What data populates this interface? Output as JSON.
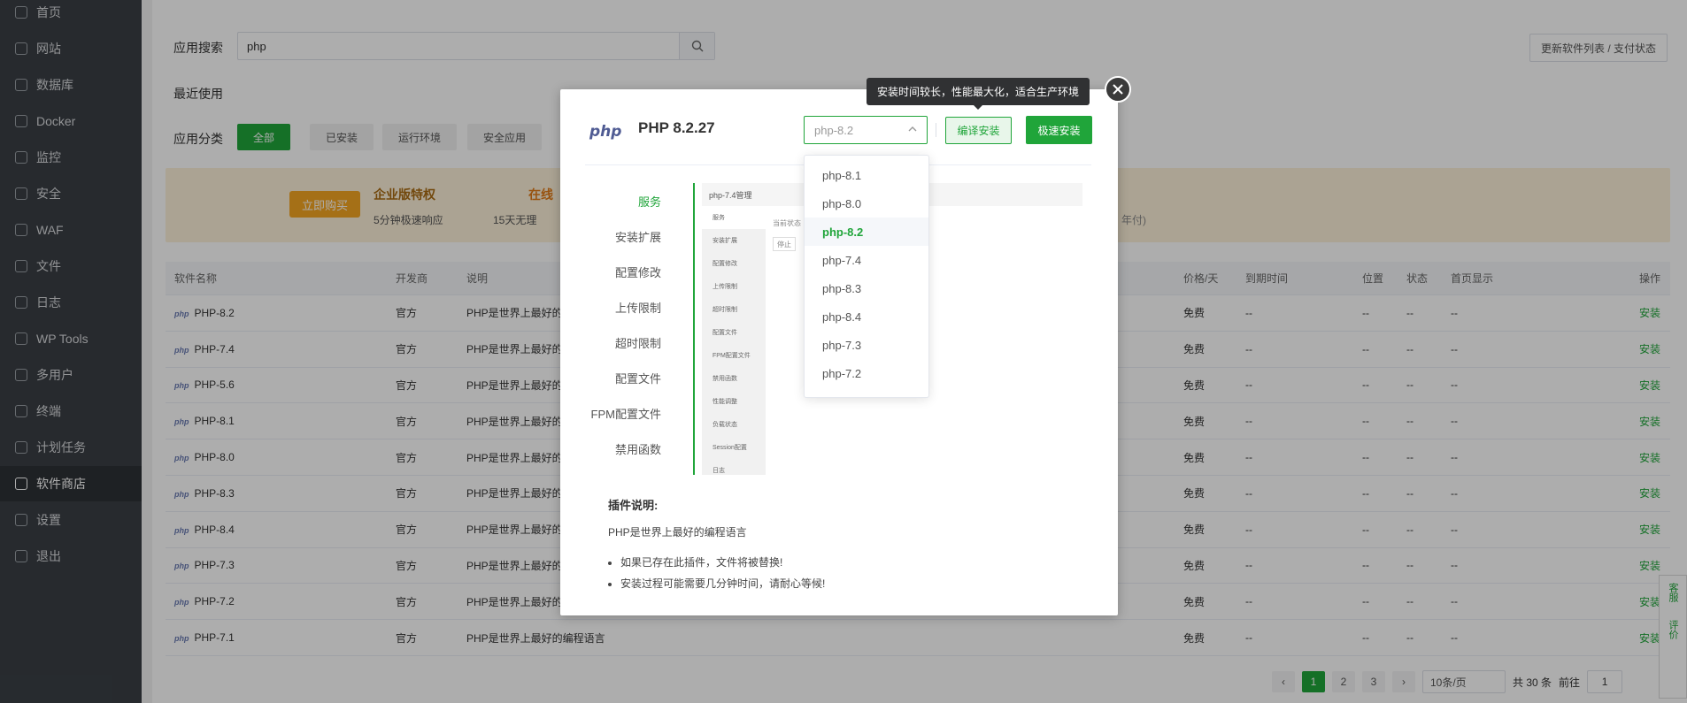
{
  "sidebar": {
    "items": [
      {
        "label": "首页",
        "icon": "home-icon"
      },
      {
        "label": "网站",
        "icon": "globe-icon"
      },
      {
        "label": "数据库",
        "icon": "database-icon"
      },
      {
        "label": "Docker",
        "icon": "docker-icon"
      },
      {
        "label": "监控",
        "icon": "monitor-icon"
      },
      {
        "label": "安全",
        "icon": "shield-icon"
      },
      {
        "label": "WAF",
        "icon": "waf-shield-icon"
      },
      {
        "label": "文件",
        "icon": "folder-icon"
      },
      {
        "label": "日志",
        "icon": "log-icon"
      },
      {
        "label": "WP Tools",
        "icon": "wordpress-icon"
      },
      {
        "label": "多用户",
        "icon": "users-icon"
      },
      {
        "label": "终端",
        "icon": "terminal-icon"
      },
      {
        "label": "计划任务",
        "icon": "calendar-icon"
      },
      {
        "label": "软件商店",
        "icon": "apps-grid-icon"
      },
      {
        "label": "设置",
        "icon": "gear-icon"
      },
      {
        "label": "退出",
        "icon": "logout-icon"
      }
    ]
  },
  "search": {
    "label": "应用搜索",
    "value": "php"
  },
  "update_button": "更新软件列表 / 支付状态",
  "recent_label": "最近使用",
  "category": {
    "label": "应用分类",
    "buttons": [
      "全部",
      "已安装",
      "运行环境",
      "安全应用"
    ]
  },
  "banner": {
    "buy": "立即购买",
    "title": "企业版特权",
    "online": "在线",
    "sub1": "5分钟极速响应",
    "sub2": "15天无理",
    "year": "年付)"
  },
  "table": {
    "headers": [
      "软件名称",
      "开发商",
      "说明",
      "价格/天",
      "到期时间",
      "位置",
      "状态",
      "首页显示",
      "操作"
    ],
    "rows": [
      {
        "name": "PHP-8.2",
        "dev": "官方",
        "desc": "PHP是世界上最好的",
        "price": "免费",
        "expire": "--",
        "pos": "--",
        "status": "--",
        "home": "--",
        "op": "安装"
      },
      {
        "name": "PHP-7.4",
        "dev": "官方",
        "desc": "PHP是世界上最好的",
        "price": "免费",
        "expire": "--",
        "pos": "--",
        "status": "--",
        "home": "--",
        "op": "安装"
      },
      {
        "name": "PHP-5.6",
        "dev": "官方",
        "desc": "PHP是世界上最好的",
        "price": "免费",
        "expire": "--",
        "pos": "--",
        "status": "--",
        "home": "--",
        "op": "安装"
      },
      {
        "name": "PHP-8.1",
        "dev": "官方",
        "desc": "PHP是世界上最好的",
        "price": "免费",
        "expire": "--",
        "pos": "--",
        "status": "--",
        "home": "--",
        "op": "安装"
      },
      {
        "name": "PHP-8.0",
        "dev": "官方",
        "desc": "PHP是世界上最好的",
        "price": "免费",
        "expire": "--",
        "pos": "--",
        "status": "--",
        "home": "--",
        "op": "安装"
      },
      {
        "name": "PHP-8.3",
        "dev": "官方",
        "desc": "PHP是世界上最好的",
        "price": "免费",
        "expire": "--",
        "pos": "--",
        "status": "--",
        "home": "--",
        "op": "安装"
      },
      {
        "name": "PHP-8.4",
        "dev": "官方",
        "desc": "PHP是世界上最好的",
        "price": "免费",
        "expire": "--",
        "pos": "--",
        "status": "--",
        "home": "--",
        "op": "安装"
      },
      {
        "name": "PHP-7.3",
        "dev": "官方",
        "desc": "PHP是世界上最好的",
        "price": "免费",
        "expire": "--",
        "pos": "--",
        "status": "--",
        "home": "--",
        "op": "安装"
      },
      {
        "name": "PHP-7.2",
        "dev": "官方",
        "desc": "PHP是世界上最好的",
        "price": "免费",
        "expire": "--",
        "pos": "--",
        "status": "--",
        "home": "--",
        "op": "安装"
      },
      {
        "name": "PHP-7.1",
        "dev": "官方",
        "desc": "PHP是世界上最好的编程语言",
        "price": "免费",
        "expire": "--",
        "pos": "--",
        "status": "--",
        "home": "--",
        "op": "安装"
      }
    ]
  },
  "pagination": {
    "pages": [
      "1",
      "2",
      "3"
    ],
    "current": "1",
    "page_size": "10条/页",
    "total": "共 30 条",
    "goto_label": "前往",
    "goto_value": "1"
  },
  "float_side": {
    "service": "客服",
    "review": "评价"
  },
  "modal": {
    "logo": "php",
    "title": "PHP 8.2.27",
    "version_selected": "php-8.2",
    "compile_button": "编译安装",
    "fast_button": "极速安装",
    "tooltip": "安装时间较长，性能最大化，适合生产环境",
    "side_items": [
      "服务",
      "安装扩展",
      "配置修改",
      "上传限制",
      "超时限制",
      "配置文件",
      "FPM配置文件",
      "禁用函数"
    ],
    "preview": {
      "head": "php-7.4管理",
      "nav": [
        "服务",
        "安装扩展",
        "配置修改",
        "上传限制",
        "超时限制",
        "配置文件",
        "FPM配置文件",
        "禁用函数",
        "性能调整",
        "负载状态",
        "Session配置",
        "日志"
      ],
      "content": "当前状态",
      "stop": "停止"
    },
    "desc_title": "插件说明:",
    "desc_text": "PHP是世界上最好的编程语言",
    "desc_list": [
      "如果已存在此插件，文件将被替换!",
      "安装过程可能需要几分钟时间，请耐心等候!"
    ]
  },
  "dropdown": {
    "options": [
      "php-8.1",
      "php-8.0",
      "php-8.2",
      "php-7.4",
      "php-8.3",
      "php-8.4",
      "php-7.3",
      "php-7.2"
    ],
    "selected": "php-8.2"
  },
  "colors": {
    "accent": "#20a53a",
    "sidebar_bg": "#3a3f45"
  }
}
